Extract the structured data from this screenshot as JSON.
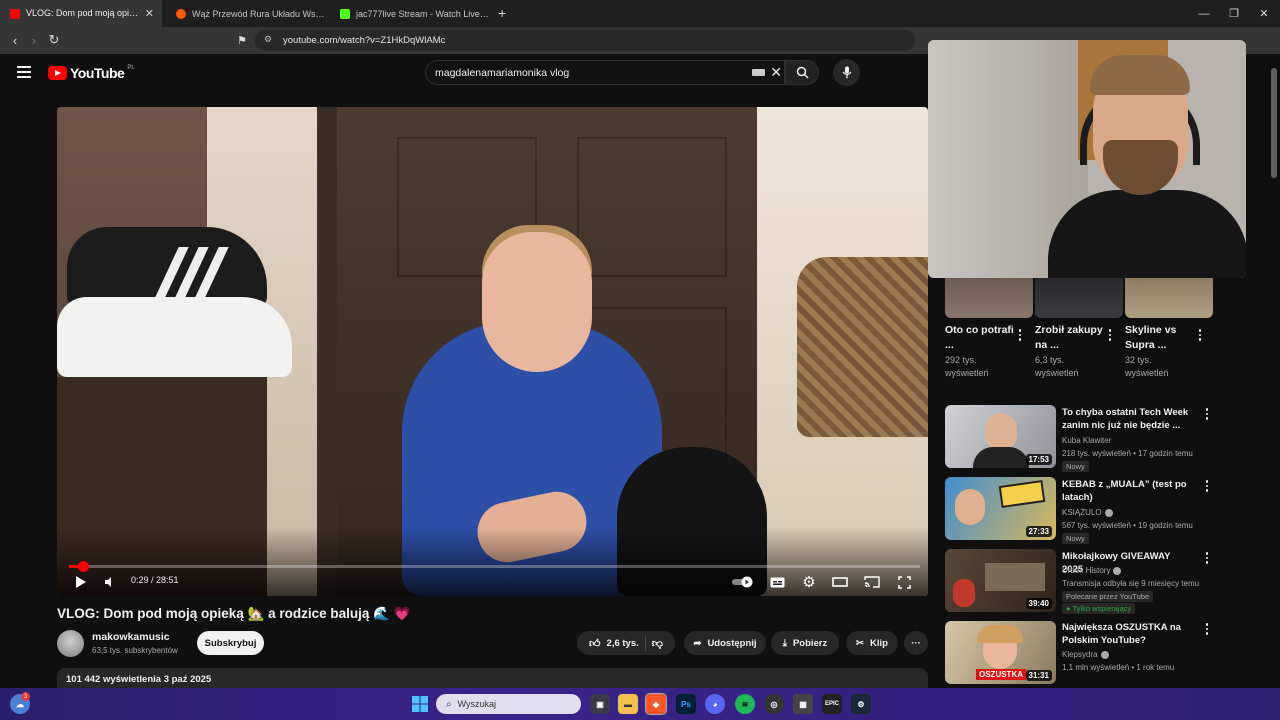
{
  "browser": {
    "tabs": [
      {
        "label": "VLOG: Dom pod moją opieką🏡",
        "active": true,
        "favicon_color": "#ff0000"
      },
      {
        "label": "Wąż Przewód Rura Układu Wspomag",
        "active": false,
        "favicon_color": "#ff5a00"
      },
      {
        "label": "jac777live Stream - Watch Live on Ki",
        "active": false,
        "favicon_color": "#53fc18"
      }
    ],
    "new_tab": "+",
    "url": "youtube.com/watch?v=Z1HkDqWlAMc"
  },
  "youtube": {
    "logo_text": "YouTube",
    "logo_region": "PL",
    "search_value": "magdalenamariamonika vlog",
    "video": {
      "time": "0:29 / 28:51",
      "progress_fraction": 0.017,
      "title": "VLOG: Dom pod moją opieką 🏡 a rodzice balują 🌊 💗",
      "channel": "makowkamusic",
      "subscribers": "63,5 tys. subskrybentów",
      "subscribe_label": "Subskrybuj",
      "likes": "2,6 tys.",
      "share_label": "Udostępnij",
      "download_label": "Pobierz",
      "clip_label": "Klip",
      "more_label": "···",
      "views_date": "101 442 wyświetlenia  3 paź 2025"
    },
    "shorts": [
      {
        "title": "Oto co potrafi ...",
        "views": "292 tys. wyświetleń"
      },
      {
        "title": "Zrobił zakupy na ...",
        "views": "6,3 tys. wyświetleń"
      },
      {
        "title": "Skyline vs Supra ...",
        "views": "32 tys. wyświetleń"
      }
    ],
    "recommended": [
      {
        "title": "To chyba ostatni Tech Week zanim nic już nie będzie ...",
        "channel": "Kuba Klawiter",
        "verified": false,
        "meta": "218 tys. wyświetleń • 17 godzin temu",
        "badge": "Nowy",
        "duration": "17:53"
      },
      {
        "title": "KEBAB z „MUALA” (test po latach)",
        "channel": "KSIĄŻULO",
        "verified": true,
        "meta": "567 tys. wyświetleń • 19 godzin temu",
        "badge": "Nowy",
        "duration": "27:33"
      },
      {
        "title": "Mikołajkowy GIVEAWAY 2025",
        "channel": "Urbex History",
        "verified": true,
        "meta": "Transmisja odbyła się 9 miesięcy temu",
        "badge": "Polecane przez YouTube",
        "badge2": "Tylko wspierający",
        "duration": "39:40"
      },
      {
        "title": "Największa OSZUSTKA na Polskim YouTube?",
        "channel": "Klepsydra",
        "verified": true,
        "meta": "1,1 mln wyświetleń • 1 rok temu",
        "badge": "",
        "duration": "31:31",
        "thumb_text": "OSZUSTKA"
      }
    ]
  },
  "taskbar": {
    "search_placeholder": "Wyszukaj",
    "weather_badge": "3"
  },
  "colors": {
    "accent": "#ff0000",
    "background": "#0f0f0f",
    "surface": "#272727"
  }
}
